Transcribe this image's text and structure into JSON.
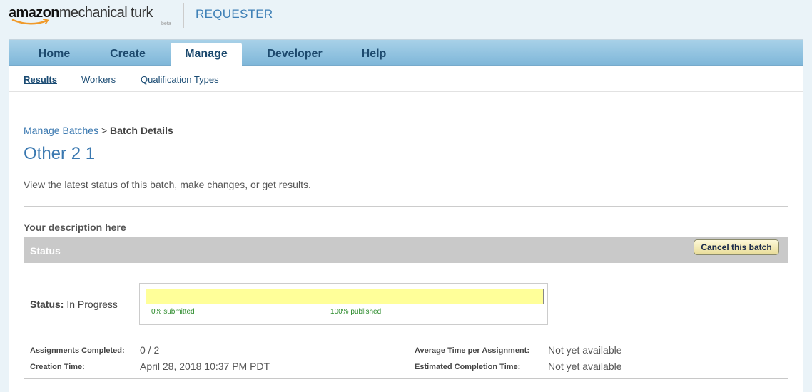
{
  "header": {
    "logo_amazon": "amazon",
    "logo_mt": "mechanical turk",
    "logo_beta": "beta",
    "section": "REQUESTER"
  },
  "tabs": [
    {
      "label": "Home",
      "active": false
    },
    {
      "label": "Create",
      "active": false
    },
    {
      "label": "Manage",
      "active": true
    },
    {
      "label": "Developer",
      "active": false
    },
    {
      "label": "Help",
      "active": false
    }
  ],
  "subnav": [
    {
      "label": "Results",
      "active": true
    },
    {
      "label": "Workers",
      "active": false
    },
    {
      "label": "Qualification Types",
      "active": false
    }
  ],
  "breadcrumb": {
    "link": "Manage Batches",
    "separator": ">",
    "current": "Batch Details"
  },
  "page": {
    "title": "Other 2 1",
    "subtitle": "View the latest status of this batch, make changes, or get results.",
    "description": "Your description here"
  },
  "status_panel": {
    "title": "Status",
    "cancel_button": "Cancel this batch",
    "status_label": "Status:",
    "status_value": "In Progress",
    "submitted_fraction": 0,
    "published_fraction": 1,
    "submitted_label": "0% submitted",
    "published_label": "100% published",
    "assignments_completed_label": "Assignments Completed:",
    "assignments_completed_value": "0 / 2",
    "creation_time_label": "Creation Time:",
    "creation_time_value": "April 28, 2018 10:37 PM PDT",
    "avg_time_label": "Average Time per Assignment:",
    "avg_time_value": "Not yet available",
    "est_completion_label": "Estimated Completion Time:",
    "est_completion_value": "Not yet available"
  },
  "colors": {
    "accent": "#3a78b0",
    "tabbar": "#8fc3e2",
    "progress_published": "#ffff99",
    "progress_label": "#2a8a2a"
  }
}
